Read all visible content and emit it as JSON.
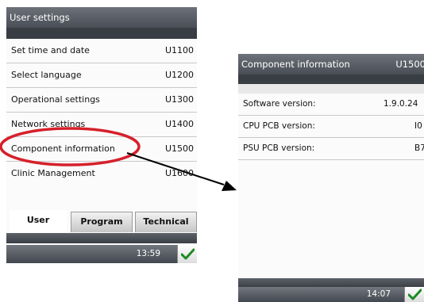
{
  "screen_left": {
    "title": "User settings",
    "menu": [
      {
        "label": "Set time and date",
        "code": "U1100"
      },
      {
        "label": "Select language",
        "code": "U1200"
      },
      {
        "label": "Operational settings",
        "code": "U1300"
      },
      {
        "label": "Network settings",
        "code": "U1400"
      },
      {
        "label": "Component information",
        "code": "U1500"
      },
      {
        "label": "Clinic Management",
        "code": "U1600"
      }
    ],
    "tabs": [
      "User",
      "Program",
      "Technical"
    ],
    "active_tab": "User",
    "time": "13:59"
  },
  "screen_right": {
    "title": "Component information",
    "code": "U1500",
    "rows": [
      {
        "label": "Software version:",
        "value": "1.9.0.24"
      },
      {
        "label": "CPU PCB version:",
        "value": "I0"
      },
      {
        "label": "PSU PCB version:",
        "value": "B7"
      }
    ],
    "time": "14:07"
  },
  "annotation": {
    "highlight_color": "#d6202a",
    "arrow_color": "#000000"
  },
  "icons": {
    "confirm": "check-icon"
  }
}
